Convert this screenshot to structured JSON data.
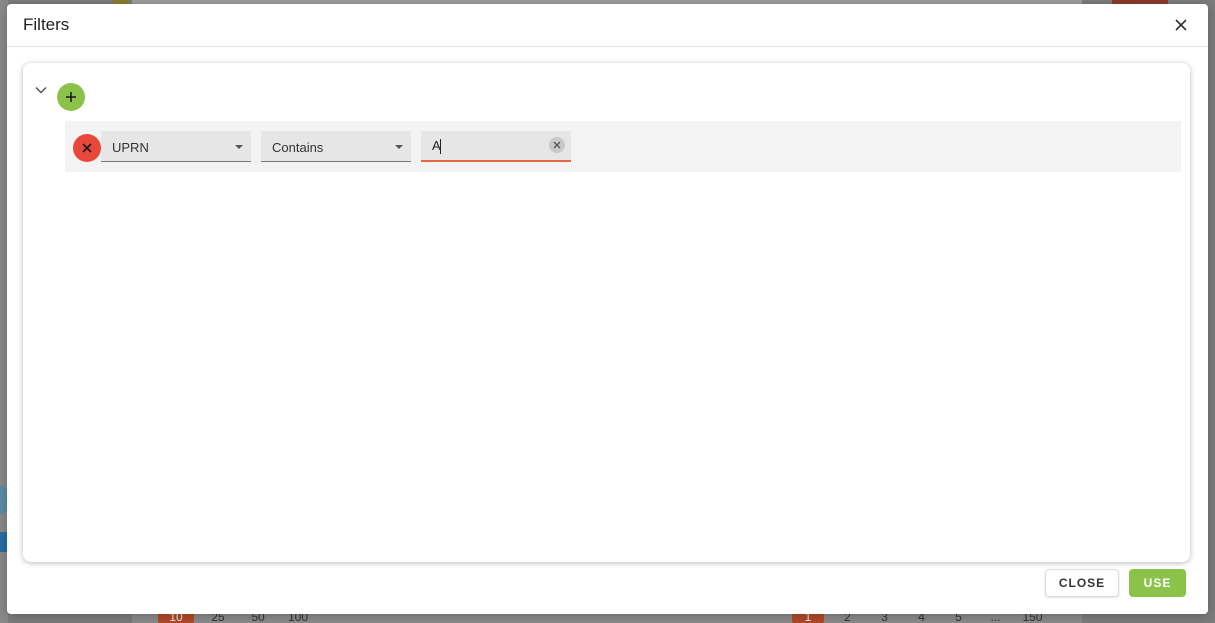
{
  "dialog": {
    "title": "Filters",
    "close_icon": "close-icon"
  },
  "query_builder": {
    "toggle_icon": "chevron-down-icon",
    "add_icon": "plus-icon",
    "rules": [
      {
        "field": "UPRN",
        "operator": "Contains",
        "value": "A",
        "remove_icon": "close-icon",
        "clear_icon": "clear-circle-icon"
      }
    ]
  },
  "footer": {
    "close_label": "CLOSE",
    "use_label": "USE"
  },
  "background": {
    "pager_left": [
      "10",
      "25",
      "50",
      "100"
    ],
    "pager_right": [
      "1",
      "2",
      "3",
      "4",
      "5",
      "...",
      "150"
    ]
  },
  "colors": {
    "accent_green": "#8bc34a",
    "danger_red": "#e8483a",
    "focus_orange": "#e8663d"
  }
}
